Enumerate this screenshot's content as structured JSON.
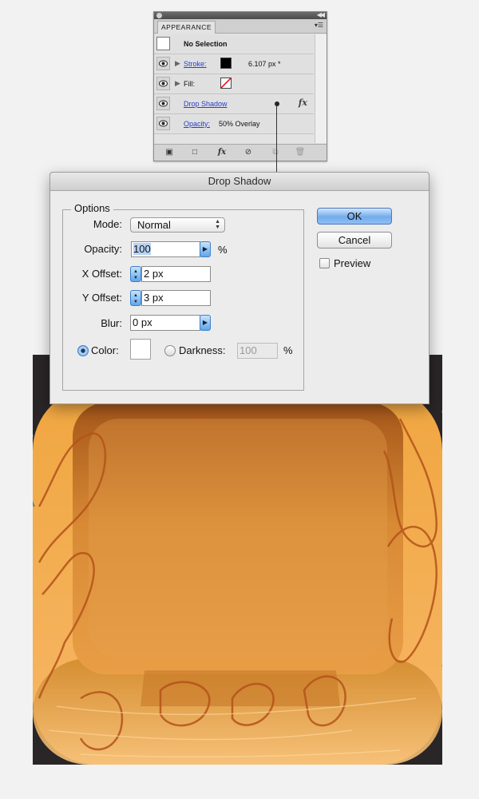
{
  "appearance_panel": {
    "tab_label": "APPEARANCE",
    "selection_label": "No Selection",
    "rows": [
      {
        "label": "Stroke:",
        "value": "6.107 px *"
      },
      {
        "label": "Fill:"
      },
      {
        "label": "Drop Shadow",
        "fx": "fx"
      },
      {
        "label": "Opacity:",
        "value": "50% Overlay"
      }
    ],
    "stroke_color": "#000000",
    "footer_fx": "fx"
  },
  "dialog": {
    "title": "Drop Shadow",
    "options_group": "Options",
    "mode_label": "Mode:",
    "mode_value": "Normal",
    "opacity_label": "Opacity:",
    "opacity_value": "100",
    "opacity_unit": "%",
    "x_offset_label": "X Offset:",
    "x_offset_value": "2 px",
    "y_offset_label": "Y Offset:",
    "y_offset_value": "3 px",
    "blur_label": "Blur:",
    "blur_value": "0 px",
    "color_label": "Color:",
    "darkness_label": "Darkness:",
    "darkness_value": "100",
    "darkness_unit": "%",
    "ok_label": "OK",
    "cancel_label": "Cancel",
    "preview_label": "Preview",
    "shadow_color": "#ffffff"
  },
  "artwork": {
    "background_color": "#2a2526",
    "icon_color_light": "#f4b860",
    "icon_color_dark": "#b86a20"
  }
}
